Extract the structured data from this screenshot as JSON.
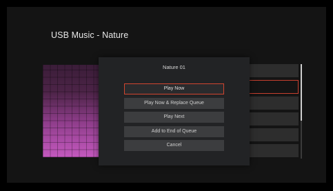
{
  "page": {
    "title": "USB Music - Nature"
  },
  "dialog": {
    "title": "Nature 01",
    "items": [
      {
        "label": "Play Now",
        "focused": true
      },
      {
        "label": "Play Now & Replace Queue"
      },
      {
        "label": "Play Next"
      },
      {
        "label": "Add to End of Queue"
      },
      {
        "label": "Cancel"
      }
    ]
  },
  "colors": {
    "focus_outline": "#d2452f",
    "album_art_bottom": "#c459bf",
    "album_art_top": "#3a1d38"
  }
}
